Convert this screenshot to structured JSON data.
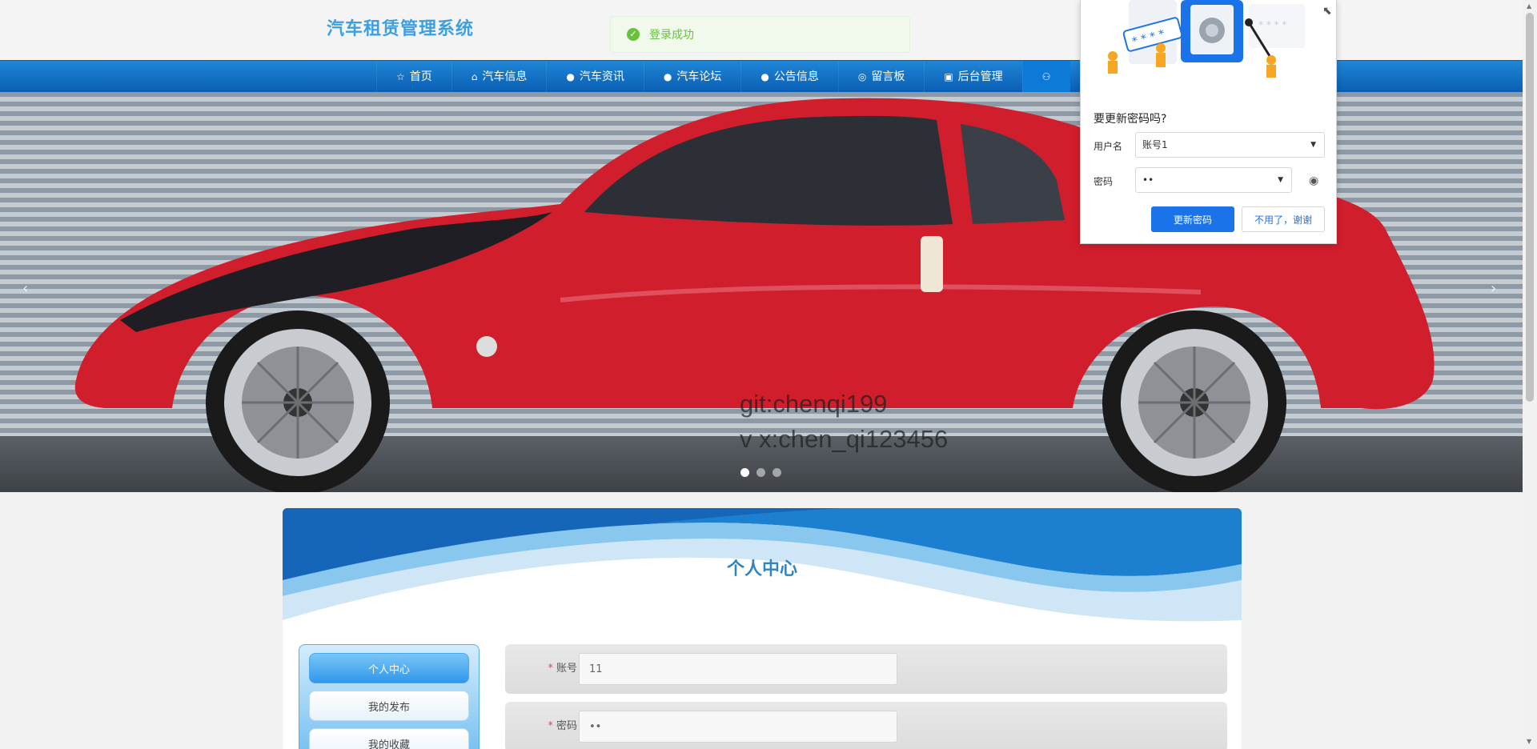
{
  "site": {
    "title": "汽车租赁管理系统"
  },
  "toast": {
    "message": "登录成功"
  },
  "nav": {
    "items": [
      {
        "label": "首页",
        "icon": "star-icon"
      },
      {
        "label": "汽车信息",
        "icon": "bag-icon"
      },
      {
        "label": "汽车资讯",
        "icon": "info-icon"
      },
      {
        "label": "汽车论坛",
        "icon": "question-icon"
      },
      {
        "label": "公告信息",
        "icon": "info-icon"
      },
      {
        "label": "留言板",
        "icon": "chat-icon"
      },
      {
        "label": "后台管理",
        "icon": "admin-icon"
      },
      {
        "label": "",
        "icon": "user-icon"
      }
    ]
  },
  "banner": {
    "watermark_line1": "git:chenqi199",
    "watermark_line2": "v x:chen_qi123456",
    "slides": 3,
    "active_slide": 1
  },
  "content": {
    "title": "个人中心",
    "menu": [
      "个人中心",
      "我的发布",
      "我的收藏"
    ],
    "form": {
      "account_label": "账号",
      "account_value": "11",
      "password_label": "密码",
      "password_value": "••"
    }
  },
  "password_popup": {
    "question": "要更新密码吗?",
    "username_label": "用户名",
    "username_value": "账号1",
    "password_label": "密码",
    "password_value": "••",
    "update_button": "更新密码",
    "dismiss_button": "不用了，谢谢"
  },
  "colors": {
    "title": "#3d9ee0",
    "nav": "#0a5fb4",
    "car": "#d01e2c",
    "primary_button": "#1a73e8",
    "success": "#67c23a"
  }
}
